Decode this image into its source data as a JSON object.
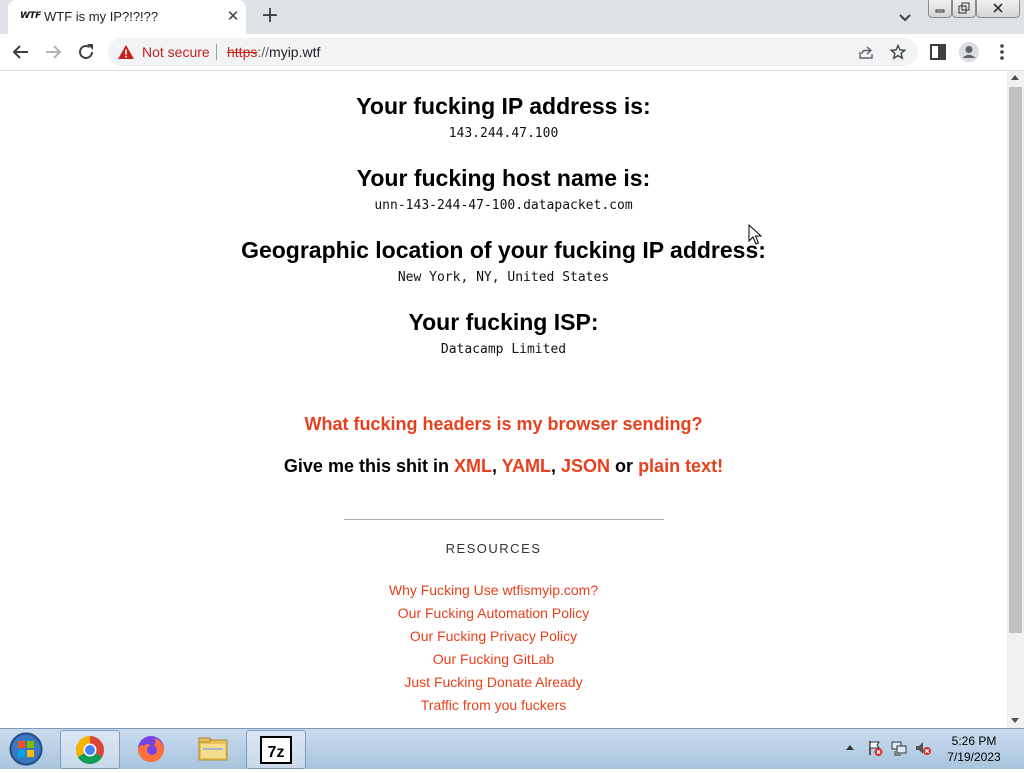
{
  "browser": {
    "tab": {
      "favicon_text": "WTF",
      "title": "WTF is my IP?!?!??"
    },
    "address_bar": {
      "security_label": "Not secure",
      "url_scheme": "https",
      "url_separator": "://",
      "url_host": "myip.wtf"
    }
  },
  "page": {
    "sections": [
      {
        "heading": "Your fucking IP address is:",
        "value": "143.244.47.100"
      },
      {
        "heading": "Your fucking host name is:",
        "value": "unn-143-244-47-100.datapacket.com"
      },
      {
        "heading": "Geographic location of your fucking IP address:",
        "value": "New York, NY, United States"
      },
      {
        "heading": "Your fucking ISP:",
        "value": "Datacamp Limited"
      }
    ],
    "headers_link": "What fucking headers is my browser sending?",
    "formats": {
      "prefix": "Give me this shit in ",
      "xml": "XML",
      "comma1": ", ",
      "yaml": "YAML",
      "comma2": ", ",
      "json": "JSON",
      "or": " or ",
      "plain": "plain text!"
    },
    "resources_title": "RESOURCES",
    "resources_links": [
      "Why Fucking Use wtfismyip.com?",
      "Our Fucking Automation Policy",
      "Our Fucking Privacy Policy",
      "Our Fucking GitLab",
      "Just Fucking Donate Already",
      "Traffic from you fuckers"
    ],
    "accent_color": "#e8401c"
  },
  "taskbar": {
    "apps": [
      "start-orb-icon",
      "chrome-icon",
      "firefox-icon",
      "file-explorer-icon",
      "7zip-icon"
    ],
    "seven_zip_label": "7z",
    "clock": {
      "time": "5:26 PM",
      "date": "7/19/2023"
    }
  }
}
